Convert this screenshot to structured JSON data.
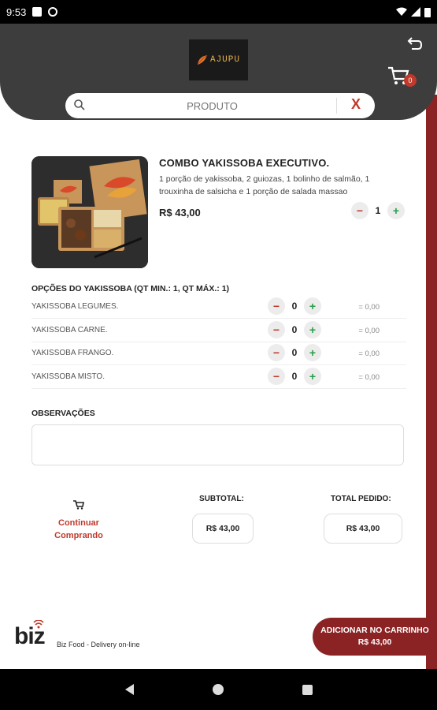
{
  "status_bar": {
    "time": "9:53"
  },
  "header": {
    "logo_text": "AJUPU",
    "cart_count": "0"
  },
  "search": {
    "placeholder": "PRODUTO",
    "clear_label": "X"
  },
  "product": {
    "title": "COMBO YAKISSOBA EXECUTIVO.",
    "description": "1 porção de yakissoba, 2 guiozas, 1 bolinho de salmão, 1 trouxinha de salsicha e 1 porção de salada massao",
    "price": "R$ 43,00",
    "quantity": "1"
  },
  "options": {
    "title": "OPÇÕES DO YAKISSOBA (QT MIN.: 1, QT MÁX.: 1)",
    "items": [
      {
        "name": "YAKISSOBA LEGUMES.",
        "qty": "0",
        "price": "= 0,00"
      },
      {
        "name": "YAKISSOBA CARNE.",
        "qty": "0",
        "price": "= 0,00"
      },
      {
        "name": "YAKISSOBA FRANGO.",
        "qty": "0",
        "price": "= 0,00"
      },
      {
        "name": "YAKISSOBA MISTO.",
        "qty": "0",
        "price": "= 0,00"
      }
    ]
  },
  "observations": {
    "title": "OBSERVAÇÕES",
    "value": ""
  },
  "totals": {
    "continue_line1": "Continuar",
    "continue_line2": "Comprando",
    "subtotal_label": "SUBTOTAL:",
    "subtotal_value": "R$ 43,00",
    "total_label": "TOTAL PEDIDO:",
    "total_value": "R$ 43,00"
  },
  "footer": {
    "brand": "biz",
    "tagline": "Biz Food - Delivery on-line",
    "add_button": "ADICIONAR NO CARRINHO R$ 43,00"
  },
  "colors": {
    "accent": "#8b2324",
    "header": "#3d3d3d",
    "minus": "#c0392b",
    "plus": "#2a9d4a"
  }
}
